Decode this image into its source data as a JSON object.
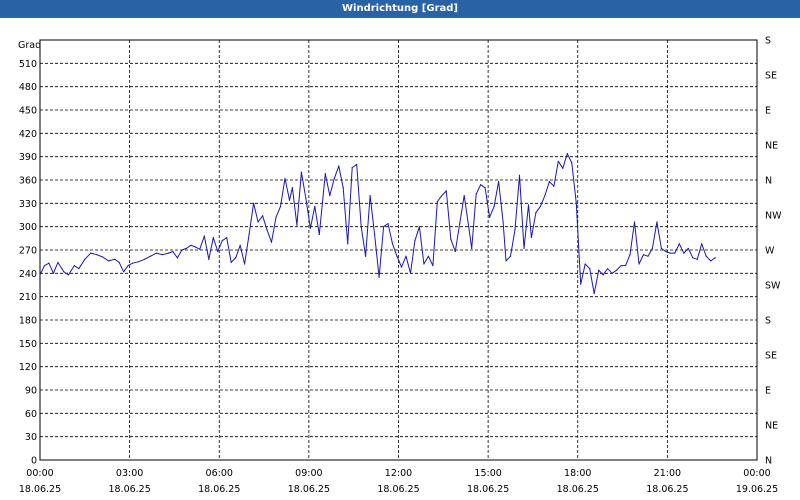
{
  "window": {
    "title": "Windrichtung [Grad]"
  },
  "chart_data": {
    "type": "line",
    "title": "Windrichtung [Grad]",
    "ylabel": "Grad",
    "xlabel": "",
    "ylim": [
      0,
      540
    ],
    "xlim": [
      "2025-06-18 00:00",
      "2025-06-19 00:00"
    ],
    "grid": true,
    "line_color": "#1a1aa8",
    "y_ticks": [
      0,
      30,
      60,
      90,
      120,
      150,
      180,
      210,
      240,
      270,
      300,
      330,
      360,
      390,
      420,
      450,
      480,
      510
    ],
    "y2_ticks": [
      {
        "value": 0,
        "label": "N"
      },
      {
        "value": 45,
        "label": "NE"
      },
      {
        "value": 90,
        "label": "E"
      },
      {
        "value": 135,
        "label": "SE"
      },
      {
        "value": 180,
        "label": "S"
      },
      {
        "value": 225,
        "label": "SW"
      },
      {
        "value": 270,
        "label": "W"
      },
      {
        "value": 315,
        "label": "NW"
      },
      {
        "value": 360,
        "label": "N"
      },
      {
        "value": 405,
        "label": "NE"
      },
      {
        "value": 450,
        "label": "E"
      },
      {
        "value": 495,
        "label": "SE"
      },
      {
        "value": 540,
        "label": "S"
      }
    ],
    "x_ticks": [
      {
        "hour": 0,
        "time": "00:00",
        "date": "18.06.25"
      },
      {
        "hour": 3,
        "time": "03:00",
        "date": "18.06.25"
      },
      {
        "hour": 6,
        "time": "06:00",
        "date": "18.06.25"
      },
      {
        "hour": 9,
        "time": "09:00",
        "date": "18.06.25"
      },
      {
        "hour": 12,
        "time": "12:00",
        "date": "18.06.25"
      },
      {
        "hour": 15,
        "time": "15:00",
        "date": "18.06.25"
      },
      {
        "hour": 18,
        "time": "18:00",
        "date": "18.06.25"
      },
      {
        "hour": 21,
        "time": "21:00",
        "date": "18.06.25"
      },
      {
        "hour": 24,
        "time": "00:00",
        "date": "19.06.25"
      }
    ],
    "series": [
      {
        "values": [
          [
            0.0,
            238
          ],
          [
            0.15,
            250
          ],
          [
            0.3,
            253
          ],
          [
            0.45,
            240
          ],
          [
            0.6,
            254
          ],
          [
            0.8,
            242
          ],
          [
            0.95,
            238
          ],
          [
            1.15,
            250
          ],
          [
            1.3,
            246
          ],
          [
            1.5,
            258
          ],
          [
            1.7,
            266
          ],
          [
            1.9,
            264
          ],
          [
            2.1,
            261
          ],
          [
            2.3,
            256
          ],
          [
            2.5,
            258
          ],
          [
            2.65,
            254
          ],
          [
            2.8,
            242
          ],
          [
            2.95,
            250
          ],
          [
            3.1,
            253
          ],
          [
            3.3,
            255
          ],
          [
            3.5,
            258
          ],
          [
            3.7,
            262
          ],
          [
            3.9,
            266
          ],
          [
            4.1,
            264
          ],
          [
            4.3,
            266
          ],
          [
            4.45,
            268
          ],
          [
            4.6,
            260
          ],
          [
            4.75,
            270
          ],
          [
            4.9,
            272
          ],
          [
            5.05,
            276
          ],
          [
            5.2,
            274
          ],
          [
            5.35,
            271
          ],
          [
            5.5,
            288
          ],
          [
            5.65,
            258
          ],
          [
            5.8,
            286
          ],
          [
            5.95,
            268
          ],
          [
            6.1,
            282
          ],
          [
            6.25,
            286
          ],
          [
            6.4,
            254
          ],
          [
            6.55,
            260
          ],
          [
            6.7,
            276
          ],
          [
            6.85,
            252
          ],
          [
            7.0,
            290
          ],
          [
            7.15,
            330
          ],
          [
            7.3,
            306
          ],
          [
            7.45,
            314
          ],
          [
            7.6,
            296
          ],
          [
            7.75,
            280
          ],
          [
            7.9,
            312
          ],
          [
            8.05,
            326
          ],
          [
            8.2,
            362
          ],
          [
            8.35,
            334
          ],
          [
            8.45,
            350
          ],
          [
            8.6,
            302
          ],
          [
            8.75,
            370
          ],
          [
            8.9,
            336
          ],
          [
            9.05,
            298
          ],
          [
            9.2,
            326
          ],
          [
            9.35,
            290
          ],
          [
            9.55,
            368
          ],
          [
            9.7,
            340
          ],
          [
            9.85,
            362
          ],
          [
            10.0,
            378
          ],
          [
            10.15,
            350
          ],
          [
            10.3,
            278
          ],
          [
            10.45,
            376
          ],
          [
            10.6,
            380
          ],
          [
            10.75,
            300
          ],
          [
            10.9,
            262
          ],
          [
            11.05,
            340
          ],
          [
            11.2,
            290
          ],
          [
            11.35,
            235
          ],
          [
            11.5,
            300
          ],
          [
            11.65,
            304
          ],
          [
            11.8,
            278
          ],
          [
            11.95,
            262
          ],
          [
            12.1,
            248
          ],
          [
            12.25,
            262
          ],
          [
            12.4,
            240
          ],
          [
            12.55,
            282
          ],
          [
            12.7,
            300
          ],
          [
            12.85,
            252
          ],
          [
            13.0,
            262
          ],
          [
            13.15,
            250
          ],
          [
            13.3,
            332
          ],
          [
            13.45,
            340
          ],
          [
            13.6,
            346
          ],
          [
            13.75,
            284
          ],
          [
            13.9,
            268
          ],
          [
            14.05,
            304
          ],
          [
            14.2,
            340
          ],
          [
            14.35,
            300
          ],
          [
            14.45,
            272
          ],
          [
            14.6,
            342
          ],
          [
            14.75,
            354
          ],
          [
            14.9,
            350
          ],
          [
            15.05,
            312
          ],
          [
            15.2,
            326
          ],
          [
            15.35,
            358
          ],
          [
            15.5,
            306
          ],
          [
            15.6,
            256
          ],
          [
            15.75,
            262
          ],
          [
            15.9,
            296
          ],
          [
            16.05,
            366
          ],
          [
            16.2,
            272
          ],
          [
            16.35,
            328
          ],
          [
            16.45,
            286
          ],
          [
            16.6,
            318
          ],
          [
            16.75,
            326
          ],
          [
            16.9,
            340
          ],
          [
            17.05,
            358
          ],
          [
            17.2,
            352
          ],
          [
            17.35,
            384
          ],
          [
            17.5,
            375
          ],
          [
            17.65,
            394
          ],
          [
            17.8,
            382
          ],
          [
            17.95,
            330
          ],
          [
            18.1,
            226
          ],
          [
            18.25,
            252
          ],
          [
            18.4,
            246
          ],
          [
            18.55,
            214
          ],
          [
            18.7,
            244
          ],
          [
            18.85,
            238
          ],
          [
            19.0,
            246
          ],
          [
            19.15,
            240
          ],
          [
            19.3,
            244
          ],
          [
            19.45,
            250
          ],
          [
            19.6,
            250
          ],
          [
            19.75,
            264
          ],
          [
            19.9,
            306
          ],
          [
            20.05,
            252
          ],
          [
            20.2,
            264
          ],
          [
            20.35,
            262
          ],
          [
            20.5,
            272
          ],
          [
            20.65,
            306
          ],
          [
            20.8,
            272
          ],
          [
            20.95,
            268
          ],
          [
            21.1,
            266
          ],
          [
            21.25,
            266
          ],
          [
            21.4,
            278
          ],
          [
            21.55,
            266
          ],
          [
            21.7,
            272
          ],
          [
            21.85,
            260
          ],
          [
            22.0,
            258
          ],
          [
            22.15,
            278
          ],
          [
            22.3,
            262
          ],
          [
            22.45,
            256
          ],
          [
            22.6,
            260
          ]
        ]
      }
    ]
  }
}
